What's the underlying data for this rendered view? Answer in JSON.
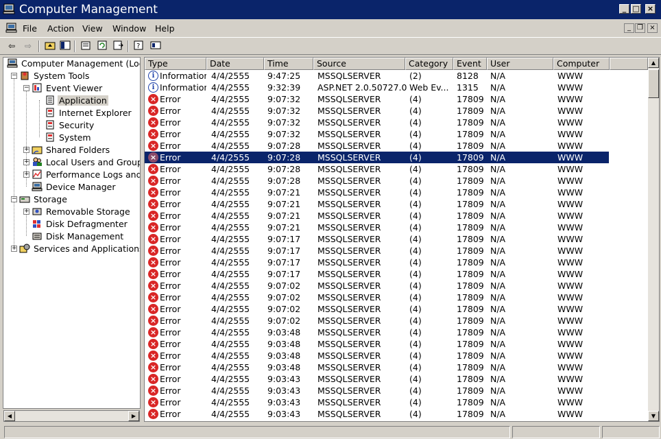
{
  "window": {
    "title": "Computer Management",
    "title_bar_color": "#0a246a",
    "selection_color": "#0a246a",
    "error_icon_color": "#d92626"
  },
  "menu": [
    "File",
    "Action",
    "View",
    "Window",
    "Help"
  ],
  "toolbar": {
    "buttons": [
      "back-arrow-icon",
      "forward-arrow-icon",
      "up-folder-icon",
      "show-hide-tree-icon",
      "properties-icon",
      "refresh-icon",
      "export-list-icon",
      "help-icon",
      "console-icon"
    ]
  },
  "tree": {
    "items": [
      {
        "label": "Computer Management (Local"
      },
      {
        "label": "System Tools"
      },
      {
        "label": "Event Viewer"
      },
      {
        "label": "Application"
      },
      {
        "label": "Internet Explorer"
      },
      {
        "label": "Security"
      },
      {
        "label": "System"
      },
      {
        "label": "Shared Folders"
      },
      {
        "label": "Local Users and Groups"
      },
      {
        "label": "Performance Logs and A"
      },
      {
        "label": "Device Manager"
      },
      {
        "label": "Storage"
      },
      {
        "label": "Removable Storage"
      },
      {
        "label": "Disk Defragmenter"
      },
      {
        "label": "Disk Management"
      },
      {
        "label": "Services and Applications"
      }
    ],
    "selected": "Application"
  },
  "list": {
    "columns": [
      "Type",
      "Date",
      "Time",
      "Source",
      "Category",
      "Event",
      "User",
      "Computer"
    ],
    "selected_row": 7,
    "rows": [
      [
        "Information",
        "4/4/2555",
        "9:47:25",
        "MSSQLSERVER",
        "(2)",
        "8128",
        "N/A",
        "WWW"
      ],
      [
        "Information",
        "4/4/2555",
        "9:32:39",
        "ASP.NET 2.0.50727.0",
        "Web Ev...",
        "1315",
        "N/A",
        "WWW"
      ],
      [
        "Error",
        "4/4/2555",
        "9:07:32",
        "MSSQLSERVER",
        "(4)",
        "17809",
        "N/A",
        "WWW"
      ],
      [
        "Error",
        "4/4/2555",
        "9:07:32",
        "MSSQLSERVER",
        "(4)",
        "17809",
        "N/A",
        "WWW"
      ],
      [
        "Error",
        "4/4/2555",
        "9:07:32",
        "MSSQLSERVER",
        "(4)",
        "17809",
        "N/A",
        "WWW"
      ],
      [
        "Error",
        "4/4/2555",
        "9:07:32",
        "MSSQLSERVER",
        "(4)",
        "17809",
        "N/A",
        "WWW"
      ],
      [
        "Error",
        "4/4/2555",
        "9:07:28",
        "MSSQLSERVER",
        "(4)",
        "17809",
        "N/A",
        "WWW"
      ],
      [
        "Error",
        "4/4/2555",
        "9:07:28",
        "MSSQLSERVER",
        "(4)",
        "17809",
        "N/A",
        "WWW"
      ],
      [
        "Error",
        "4/4/2555",
        "9:07:28",
        "MSSQLSERVER",
        "(4)",
        "17809",
        "N/A",
        "WWW"
      ],
      [
        "Error",
        "4/4/2555",
        "9:07:28",
        "MSSQLSERVER",
        "(4)",
        "17809",
        "N/A",
        "WWW"
      ],
      [
        "Error",
        "4/4/2555",
        "9:07:21",
        "MSSQLSERVER",
        "(4)",
        "17809",
        "N/A",
        "WWW"
      ],
      [
        "Error",
        "4/4/2555",
        "9:07:21",
        "MSSQLSERVER",
        "(4)",
        "17809",
        "N/A",
        "WWW"
      ],
      [
        "Error",
        "4/4/2555",
        "9:07:21",
        "MSSQLSERVER",
        "(4)",
        "17809",
        "N/A",
        "WWW"
      ],
      [
        "Error",
        "4/4/2555",
        "9:07:21",
        "MSSQLSERVER",
        "(4)",
        "17809",
        "N/A",
        "WWW"
      ],
      [
        "Error",
        "4/4/2555",
        "9:07:17",
        "MSSQLSERVER",
        "(4)",
        "17809",
        "N/A",
        "WWW"
      ],
      [
        "Error",
        "4/4/2555",
        "9:07:17",
        "MSSQLSERVER",
        "(4)",
        "17809",
        "N/A",
        "WWW"
      ],
      [
        "Error",
        "4/4/2555",
        "9:07:17",
        "MSSQLSERVER",
        "(4)",
        "17809",
        "N/A",
        "WWW"
      ],
      [
        "Error",
        "4/4/2555",
        "9:07:17",
        "MSSQLSERVER",
        "(4)",
        "17809",
        "N/A",
        "WWW"
      ],
      [
        "Error",
        "4/4/2555",
        "9:07:02",
        "MSSQLSERVER",
        "(4)",
        "17809",
        "N/A",
        "WWW"
      ],
      [
        "Error",
        "4/4/2555",
        "9:07:02",
        "MSSQLSERVER",
        "(4)",
        "17809",
        "N/A",
        "WWW"
      ],
      [
        "Error",
        "4/4/2555",
        "9:07:02",
        "MSSQLSERVER",
        "(4)",
        "17809",
        "N/A",
        "WWW"
      ],
      [
        "Error",
        "4/4/2555",
        "9:07:02",
        "MSSQLSERVER",
        "(4)",
        "17809",
        "N/A",
        "WWW"
      ],
      [
        "Error",
        "4/4/2555",
        "9:03:48",
        "MSSQLSERVER",
        "(4)",
        "17809",
        "N/A",
        "WWW"
      ],
      [
        "Error",
        "4/4/2555",
        "9:03:48",
        "MSSQLSERVER",
        "(4)",
        "17809",
        "N/A",
        "WWW"
      ],
      [
        "Error",
        "4/4/2555",
        "9:03:48",
        "MSSQLSERVER",
        "(4)",
        "17809",
        "N/A",
        "WWW"
      ],
      [
        "Error",
        "4/4/2555",
        "9:03:48",
        "MSSQLSERVER",
        "(4)",
        "17809",
        "N/A",
        "WWW"
      ],
      [
        "Error",
        "4/4/2555",
        "9:03:43",
        "MSSQLSERVER",
        "(4)",
        "17809",
        "N/A",
        "WWW"
      ],
      [
        "Error",
        "4/4/2555",
        "9:03:43",
        "MSSQLSERVER",
        "(4)",
        "17809",
        "N/A",
        "WWW"
      ],
      [
        "Error",
        "4/4/2555",
        "9:03:43",
        "MSSQLSERVER",
        "(4)",
        "17809",
        "N/A",
        "WWW"
      ],
      [
        "Error",
        "4/4/2555",
        "9:03:43",
        "MSSQLSERVER",
        "(4)",
        "17809",
        "N/A",
        "WWW"
      ]
    ]
  }
}
